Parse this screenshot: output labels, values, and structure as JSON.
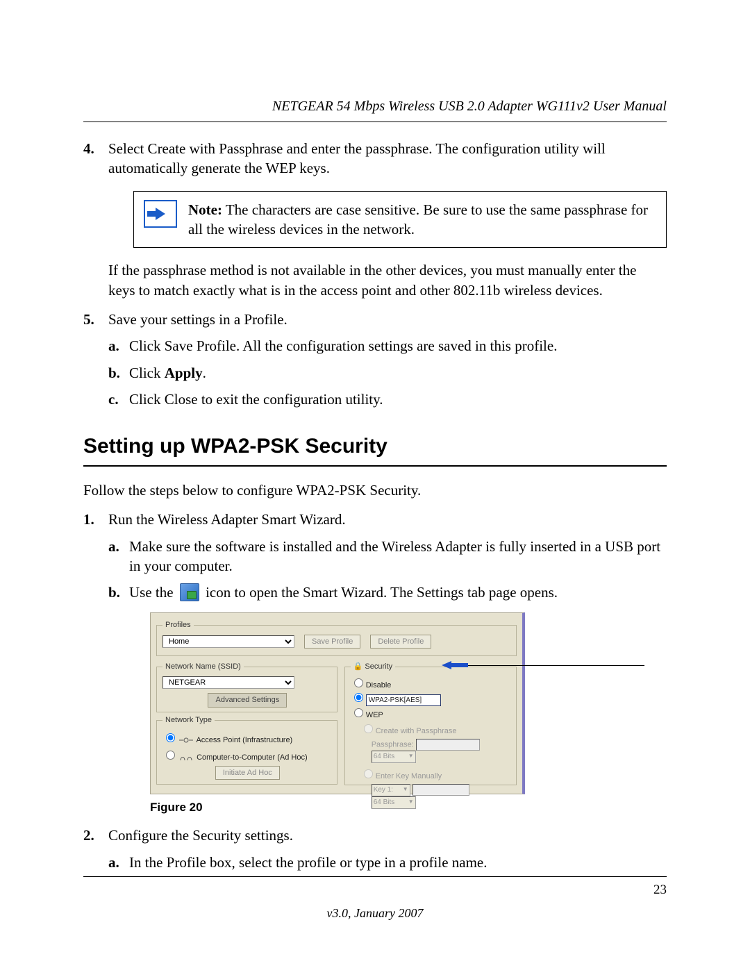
{
  "header": {
    "running_head": "NETGEAR 54 Mbps Wireless USB 2.0 Adapter WG111v2 User Manual"
  },
  "step4": {
    "marker": "4.",
    "text": "Select Create with Passphrase and enter the passphrase. The configuration utility will automatically generate the WEP keys."
  },
  "note": {
    "label": "Note:",
    "text": " The characters are case sensitive. Be sure to use the same passphrase for all the wireless devices in the network."
  },
  "after_note": "If the passphrase method is not available in the other devices, you must manually enter the keys to match exactly what is in the access point and other 802.11b wireless devices.",
  "step5": {
    "marker": "5.",
    "text": "Save your settings in a Profile.",
    "a_marker": "a.",
    "a_text": "Click Save Profile. All the configuration settings are saved in this profile.",
    "b_marker": "b.",
    "b_prefix": "Click ",
    "b_bold": "Apply",
    "b_suffix": ".",
    "c_marker": "c.",
    "c_text": "Click Close to exit the configuration utility."
  },
  "section_title": "Setting up WPA2-PSK Security",
  "intro": "Follow the steps below to configure WPA2-PSK Security.",
  "s1": {
    "marker": "1.",
    "text": "Run the Wireless Adapter Smart Wizard.",
    "a_marker": "a.",
    "a_text": "Make sure the software is installed and the Wireless Adapter is fully inserted in a USB port in your computer.",
    "b_marker": "b.",
    "b_prefix": "Use the ",
    "b_suffix": " icon to open the Smart Wizard. The Settings tab page opens."
  },
  "screenshot": {
    "profiles_legend": "Profiles",
    "profile_value": "Home",
    "save_profile": "Save Profile",
    "delete_profile": "Delete Profile",
    "ssid_legend": "Network Name (SSID)",
    "ssid_value": "NETGEAR",
    "advanced_settings": "Advanced Settings",
    "network_type_legend": "Network Type",
    "ap_label": "Access Point (Infrastructure)",
    "adhoc_label": "Computer-to-Computer (Ad Hoc)",
    "initiate_adhoc": "Initiate Ad Hoc",
    "security_legend": "Security",
    "disable_label": "Disable",
    "wpa2_label": "WPA2-PSK[AES]",
    "wep_label": "WEP",
    "create_passphrase": "Create with Passphrase",
    "passphrase_label": "Passphrase:",
    "bits1": "64 Bits",
    "enter_key": "Enter Key Manually",
    "key_label": "Key 1:",
    "bits2": "64 Bits"
  },
  "figure_caption": "Figure 20",
  "s2": {
    "marker": "2.",
    "text": "Configure the Security settings.",
    "a_marker": "a.",
    "a_text": "In the Profile box, select the profile or type in a profile name."
  },
  "footer": {
    "page_number": "23",
    "version": "v3.0, January 2007"
  }
}
